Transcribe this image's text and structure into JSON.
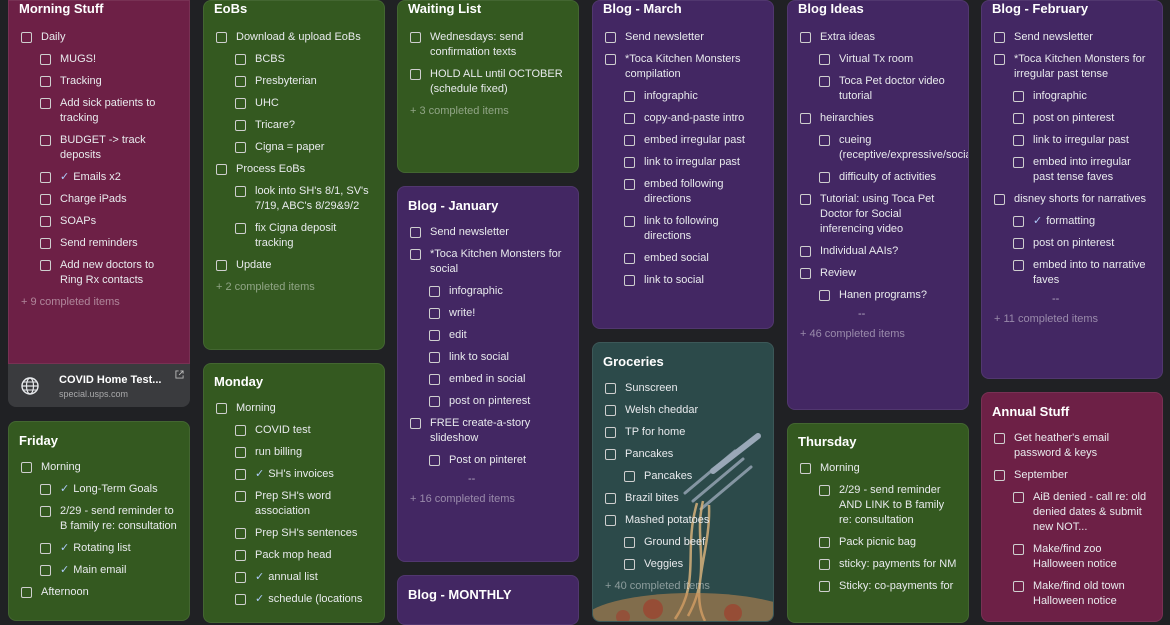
{
  "colors": {
    "background": "#202124",
    "red": "#6d2046",
    "green": "#345920",
    "purple": "#432763",
    "teal": "#2c4a4a",
    "check": "#aecbfa"
  },
  "notes": {
    "morning": {
      "title": "Morning Stuff",
      "items": [
        {
          "text": "Daily",
          "level": 0
        },
        {
          "text": "MUGS!",
          "level": 1
        },
        {
          "text": "Tracking",
          "level": 1
        },
        {
          "text": "Add sick patients to tracking",
          "level": 1
        },
        {
          "text": "BUDGET -> track deposits",
          "level": 1
        },
        {
          "text": "Emails x2",
          "level": 1,
          "check": true
        },
        {
          "text": "Charge iPads",
          "level": 1
        },
        {
          "text": "SOAPs",
          "level": 1
        },
        {
          "text": "Send reminders",
          "level": 1
        },
        {
          "text": "Add new doctors to Ring Rx contacts",
          "level": 1
        }
      ],
      "completed": "+ 9 completed items"
    },
    "link": {
      "title": "COVID Home Test...",
      "url": "special.usps.com",
      "icon": "globe-icon"
    },
    "friday": {
      "title": "Friday",
      "items": [
        {
          "text": "Morning",
          "level": 0
        },
        {
          "text": "Long-Term Goals",
          "level": 1,
          "check": true
        },
        {
          "text": "2/29 - send reminder to B family re: consultation",
          "level": 1
        },
        {
          "text": "Rotating list",
          "level": 1,
          "check": true
        },
        {
          "text": "Main email",
          "level": 1,
          "check": true
        },
        {
          "text": "Afternoon",
          "level": 0
        }
      ]
    },
    "eobs": {
      "title": "EoBs",
      "items": [
        {
          "text": "Download & upload EoBs",
          "level": 0
        },
        {
          "text": "BCBS",
          "level": 1
        },
        {
          "text": "Presbyterian",
          "level": 1
        },
        {
          "text": "UHC",
          "level": 1
        },
        {
          "text": "Tricare?",
          "level": 1
        },
        {
          "text": "Cigna = paper",
          "level": 1
        },
        {
          "text": "Process EoBs",
          "level": 0
        },
        {
          "text": "look into SH's 8/1, SV's 7/19, ABC's 8/29&9/2",
          "level": 1
        },
        {
          "text": "fix Cigna deposit tracking",
          "level": 1
        },
        {
          "text": "Update",
          "level": 0
        }
      ],
      "completed": "+ 2 completed items"
    },
    "monday": {
      "title": "Monday",
      "items": [
        {
          "text": "Morning",
          "level": 0
        },
        {
          "text": "COVID test",
          "level": 1
        },
        {
          "text": "run billing",
          "level": 1
        },
        {
          "text": "SH's invoices",
          "level": 1,
          "check": true
        },
        {
          "text": "Prep SH's word association",
          "level": 1
        },
        {
          "text": "Prep SH's sentences",
          "level": 1
        },
        {
          "text": "Pack mop head",
          "level": 1
        },
        {
          "text": "annual list",
          "level": 1,
          "check": true
        },
        {
          "text": "schedule (locations",
          "level": 1,
          "check": true
        }
      ]
    },
    "waiting": {
      "title": "Waiting List",
      "items": [
        {
          "text": "Wednesdays: send confirmation texts",
          "level": 0
        },
        {
          "text": "HOLD ALL until OCTOBER (schedule fixed)",
          "level": 0
        }
      ],
      "completed": "+ 3 completed items"
    },
    "blog_jan": {
      "title": "Blog - January",
      "items": [
        {
          "text": "Send newsletter",
          "level": 0
        },
        {
          "text": "*Toca Kitchen Monsters for social",
          "level": 0
        },
        {
          "text": "infographic",
          "level": 1
        },
        {
          "text": "write!",
          "level": 1
        },
        {
          "text": "edit",
          "level": 1
        },
        {
          "text": "link to social",
          "level": 1
        },
        {
          "text": "embed in social",
          "level": 1
        },
        {
          "text": "post on pinterest",
          "level": 1
        },
        {
          "text": "FREE create-a-story slideshow",
          "level": 0
        },
        {
          "text": "Post on pinteret",
          "level": 1
        }
      ],
      "dash": "--",
      "completed": "+ 16 completed items"
    },
    "blog_monthly": {
      "title": "Blog - MONTHLY"
    },
    "blog_march": {
      "title": "Blog - March",
      "items": [
        {
          "text": "Send newsletter",
          "level": 0
        },
        {
          "text": "*Toca Kitchen Monsters compilation",
          "level": 0
        },
        {
          "text": "infographic",
          "level": 1
        },
        {
          "text": "copy-and-paste intro",
          "level": 1
        },
        {
          "text": "embed irregular past",
          "level": 1
        },
        {
          "text": "link to irregular past",
          "level": 1
        },
        {
          "text": "embed following directions",
          "level": 1
        },
        {
          "text": "link to following directions",
          "level": 1
        },
        {
          "text": "embed social",
          "level": 1
        },
        {
          "text": "link to social",
          "level": 1
        }
      ]
    },
    "groceries": {
      "title": "Groceries",
      "items": [
        {
          "text": "Sunscreen",
          "level": 0
        },
        {
          "text": "Welsh cheddar",
          "level": 0
        },
        {
          "text": "TP for home",
          "level": 0
        },
        {
          "text": "Pancakes",
          "level": 0
        },
        {
          "text": "Pancakes",
          "level": 1
        },
        {
          "text": "Brazil bites",
          "level": 0
        },
        {
          "text": "Mashed potatoes",
          "level": 0
        },
        {
          "text": "Ground beef",
          "level": 1
        },
        {
          "text": "Veggies",
          "level": 1
        }
      ],
      "completed": "+ 40 completed items"
    },
    "blog_ideas": {
      "title": "Blog Ideas",
      "items": [
        {
          "text": "Extra ideas",
          "level": 0
        },
        {
          "text": "Virtual Tx room",
          "level": 1
        },
        {
          "text": "Toca Pet doctor video tutorial",
          "level": 1
        },
        {
          "text": "heirarchies",
          "level": 0
        },
        {
          "text": "cueing (receptive/expressive/social/fluency)",
          "level": 1
        },
        {
          "text": "difficulty of activities",
          "level": 1
        },
        {
          "text": "Tutorial: using Toca Pet Doctor for Social inferencing video",
          "level": 0
        },
        {
          "text": "Individual AAIs?",
          "level": 0
        },
        {
          "text": "Review",
          "level": 0
        },
        {
          "text": "Hanen programs?",
          "level": 1
        }
      ],
      "dash": "--",
      "completed": "+ 46 completed items"
    },
    "thursday": {
      "title": "Thursday",
      "items": [
        {
          "text": "Morning",
          "level": 0
        },
        {
          "text": "2/29 - send reminder AND LINK to B family re: consultation",
          "level": 1
        },
        {
          "text": "Pack picnic bag",
          "level": 1
        },
        {
          "text": "sticky: payments for NM",
          "level": 1
        },
        {
          "text": "Sticky: co-payments for",
          "level": 1
        }
      ]
    },
    "blog_feb": {
      "title": "Blog - February",
      "items": [
        {
          "text": "Send newsletter",
          "level": 0
        },
        {
          "text": "*Toca Kitchen Monsters for irregular past tense",
          "level": 0
        },
        {
          "text": "infographic",
          "level": 1
        },
        {
          "text": "post on pinterest",
          "level": 1
        },
        {
          "text": "link to irregular past",
          "level": 1
        },
        {
          "text": "embed into irregular past tense faves",
          "level": 1
        },
        {
          "text": "disney shorts for narratives",
          "level": 0
        },
        {
          "text": "formatting",
          "level": 1,
          "check": true
        },
        {
          "text": "post on pinterest",
          "level": 1
        },
        {
          "text": "embed into to narrative faves",
          "level": 1
        }
      ],
      "dash": "--",
      "completed": "+ 11 completed items"
    },
    "annual": {
      "title": "Annual Stuff",
      "items": [
        {
          "text": "Get heather's email password & keys",
          "level": 0
        },
        {
          "text": "September",
          "level": 0
        },
        {
          "text": "AiB denied - call re: old denied dates & submit new NOT...",
          "level": 1
        },
        {
          "text": "Make/find zoo Halloween notice",
          "level": 1
        },
        {
          "text": "Make/find old town Halloween notice",
          "level": 1
        }
      ]
    }
  }
}
